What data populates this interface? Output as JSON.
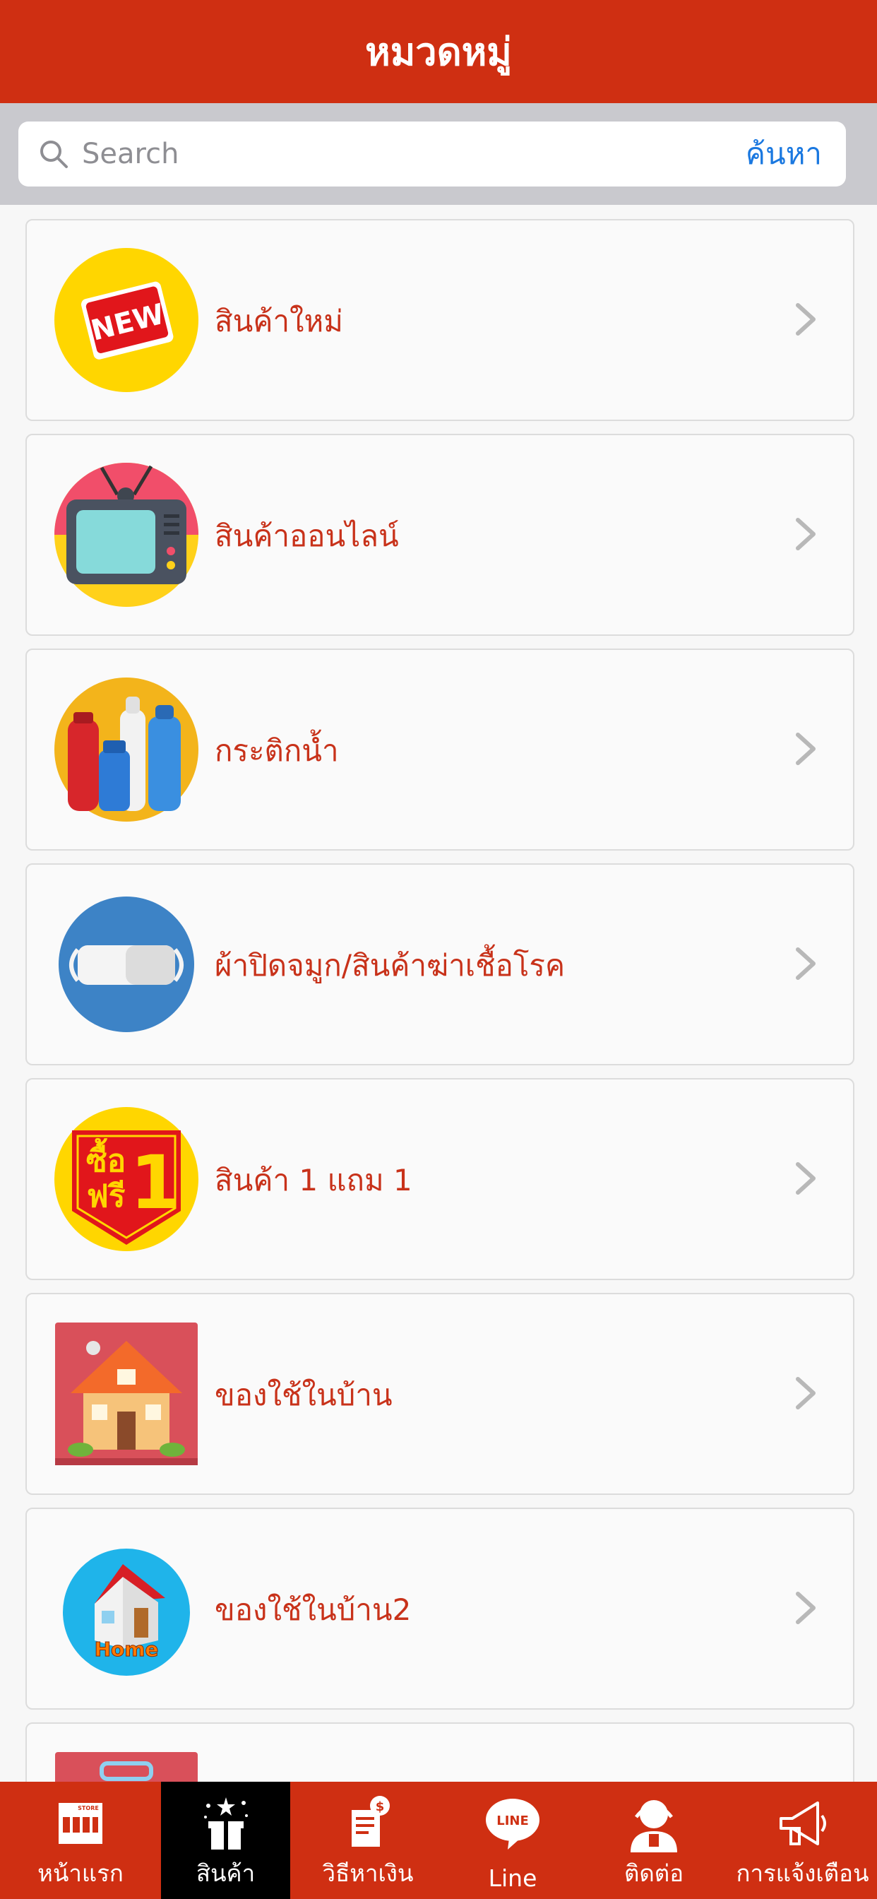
{
  "header": {
    "title": "หมวดหมู่"
  },
  "search": {
    "placeholder": "Search",
    "button_label": "ค้นหา"
  },
  "categories": [
    {
      "label": "สินค้าใหม่",
      "icon": "new-badge-icon"
    },
    {
      "label": "สินค้าออนไลน์",
      "icon": "tv-icon"
    },
    {
      "label": "กระติกน้ำ",
      "icon": "water-bottles-icon"
    },
    {
      "label": "ผ้าปิดจมูก/สินค้าฆ่าเชื้อโรค",
      "icon": "face-mask-icon"
    },
    {
      "label": "สินค้า 1 แถม 1",
      "icon": "buy-one-free-one-icon"
    },
    {
      "label": "ของใช้ในบ้าน",
      "icon": "house-icon"
    },
    {
      "label": "ของใช้ในบ้าน2",
      "icon": "home-icon"
    },
    {
      "label": "",
      "icon": "bag-icon"
    }
  ],
  "thumb_text": {
    "new_badge": "NEW",
    "promo_line1": "ซื้อ",
    "promo_line2": "ฟรี",
    "promo_number": "1",
    "home_badge": "Home"
  },
  "tabbar": {
    "items": [
      {
        "label": "หน้าแรก",
        "icon": "store-icon",
        "icon_text": "STORE"
      },
      {
        "label": "สินค้า",
        "icon": "gift-box-icon"
      },
      {
        "label": "วิธีหาเงิน",
        "icon": "receipt-money-icon"
      },
      {
        "label": "Line",
        "icon": "line-chat-icon",
        "icon_text": "LINE"
      },
      {
        "label": "ติดต่อ",
        "icon": "support-agent-icon"
      },
      {
        "label": "การแจ้งเตือน",
        "icon": "megaphone-icon"
      }
    ],
    "active_index": 1
  },
  "colors": {
    "brand_red": "#cf2f12",
    "label_red": "#c8321a",
    "link_blue": "#1a78e0",
    "active_tab": "#000000"
  }
}
